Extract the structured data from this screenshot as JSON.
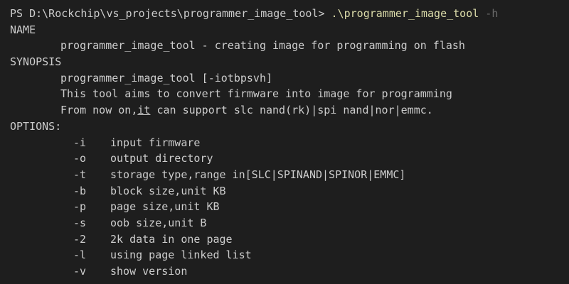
{
  "terminal": {
    "prompt": "PS D:\\Rockchip\\vs_projects\\programmer_image_tool> ",
    "command": ".\\programmer_image_tool",
    "argument": " -h",
    "name_heading": "NAME",
    "name_description": "programmer_image_tool - creating image for programming on flash",
    "synopsis_heading": "SYNOPSIS",
    "synopsis_usage": "programmer_image_tool [-iotbpsvh]",
    "synopsis_line1": "This tool aims to convert firmware into image for programming",
    "synopsis_line2_prefix": "From now on,",
    "synopsis_line2_underlined": "it",
    "synopsis_line2_suffix": " can support slc nand(rk)|spi nand|nor|emmc.",
    "options_heading": "OPTIONS:",
    "options": [
      {
        "flag": "-i",
        "description": "input firmware"
      },
      {
        "flag": "-o",
        "description": "output directory"
      },
      {
        "flag": "-t",
        "description": "storage type,range in[SLC|SPINAND|SPINOR|EMMC]"
      },
      {
        "flag": "-b",
        "description": "block size,unit KB"
      },
      {
        "flag": "-p",
        "description": "page size,unit KB"
      },
      {
        "flag": "-s",
        "description": "oob size,unit B"
      },
      {
        "flag": "-2",
        "description": "2k data in one page"
      },
      {
        "flag": "-l",
        "description": "using page linked list"
      },
      {
        "flag": "-v",
        "description": "show version"
      }
    ]
  },
  "colors": {
    "background": "#1e1e1e",
    "text": "#cccccc",
    "command": "#dcdcaa",
    "argument": "#6b6b6b"
  }
}
